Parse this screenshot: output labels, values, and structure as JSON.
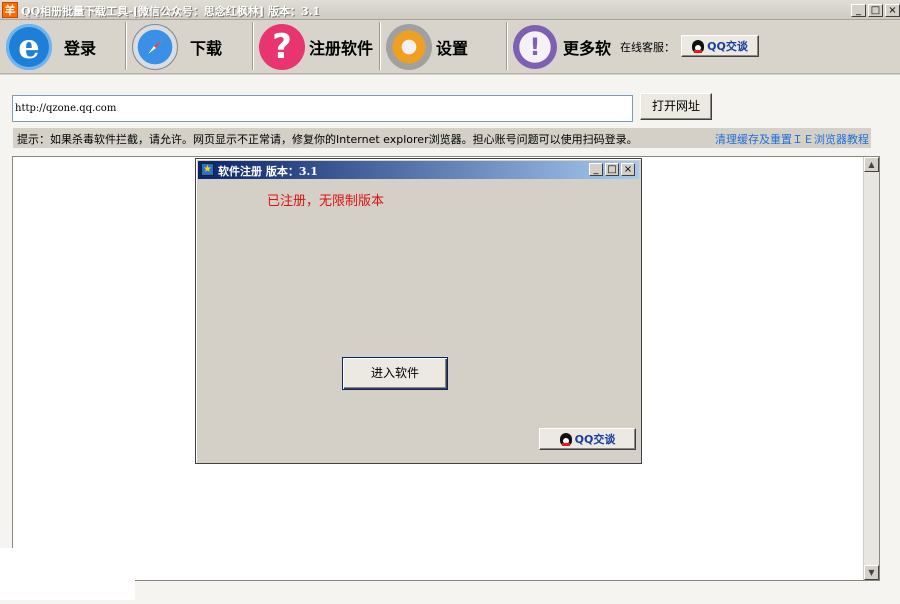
{
  "window": {
    "title": "QQ相册批量下载工具-[微信公众号：思念红枫林] 版本：3.1",
    "app_icon_glyph": "羊",
    "controls": {
      "minimize": "_",
      "maximize": "□",
      "close": "×"
    }
  },
  "toolbar": {
    "items": [
      {
        "label": "登录",
        "icon": "ie-icon",
        "glyph": "e"
      },
      {
        "label": "下载",
        "icon": "compass-icon",
        "glyph": ""
      },
      {
        "label": "注册软件",
        "icon": "help-icon",
        "glyph": "?"
      },
      {
        "label": "设置",
        "icon": "gear-icon",
        "glyph": ""
      },
      {
        "label": "更多软",
        "icon": "more-icon",
        "glyph": "!"
      }
    ],
    "customer_service_label": "在线客服：",
    "qq_chat_label": "QQ交谈"
  },
  "address": {
    "url": "http://qzone.qq.com",
    "open_button": "打开网址"
  },
  "tip": {
    "text": "提示：如果杀毒软件拦截，请允许。网页显示不正常请，修复你的Internet explorer浏览器。担心账号问题可以使用扫码登录。",
    "link": "清理缓存及重置ＩＥ浏览器教程"
  },
  "dialog": {
    "title": "软件注册 版本：3.1",
    "status": "已注册，无限制版本",
    "enter_button": "进入软件",
    "qq_chat_label": "QQ交谈"
  },
  "colors": {
    "status_red": "#e01010",
    "link_blue": "#1e6fd6",
    "dialog_title_start": "#0a246a",
    "dialog_title_end": "#a6caf0"
  }
}
